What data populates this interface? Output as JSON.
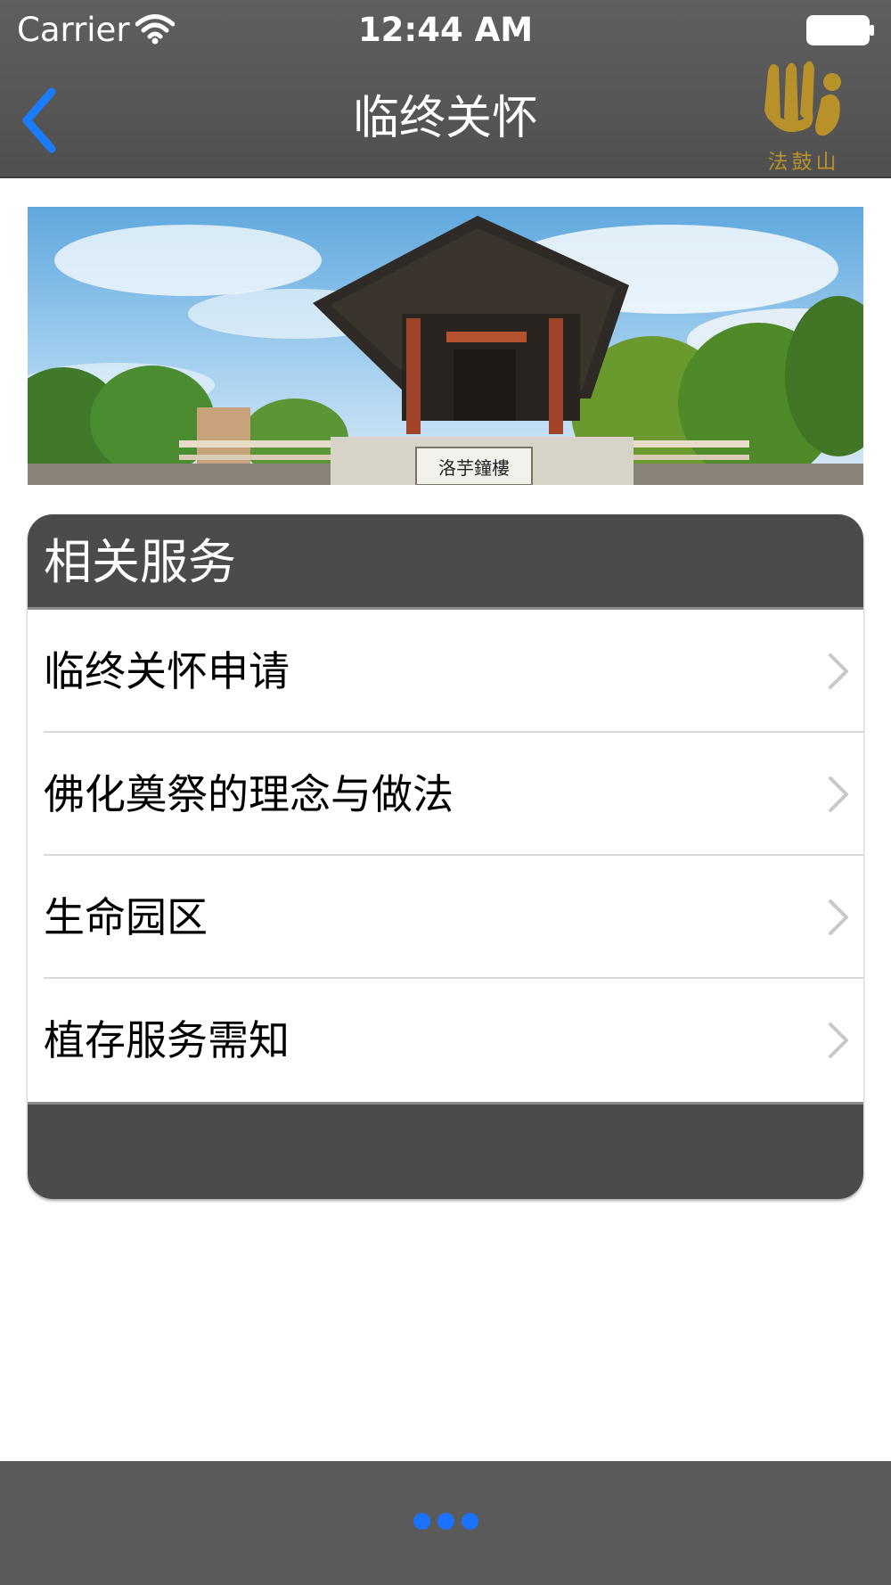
{
  "status_bar": {
    "carrier": "Carrier",
    "time": "12:44 AM",
    "wifi_icon": "wifi-icon",
    "battery_icon": "battery-icon"
  },
  "nav_bar": {
    "title": "临终关怀",
    "back_icon": "chevron-left-icon",
    "logo_text": "法鼓山",
    "accent_color": "#1a7cff",
    "logo_color": "#b8912a"
  },
  "banner": {
    "sign_text": "洛芋鐘樓"
  },
  "services": {
    "title": "相关服务",
    "items": [
      {
        "label": "临终关怀申请"
      },
      {
        "label": "佛化奠祭的理念与做法"
      },
      {
        "label": "生命园区"
      },
      {
        "label": "植存服务需知"
      }
    ],
    "chevron_icon": "chevron-right-icon"
  },
  "pager": {
    "count": 3,
    "color": "#1a72ff"
  }
}
